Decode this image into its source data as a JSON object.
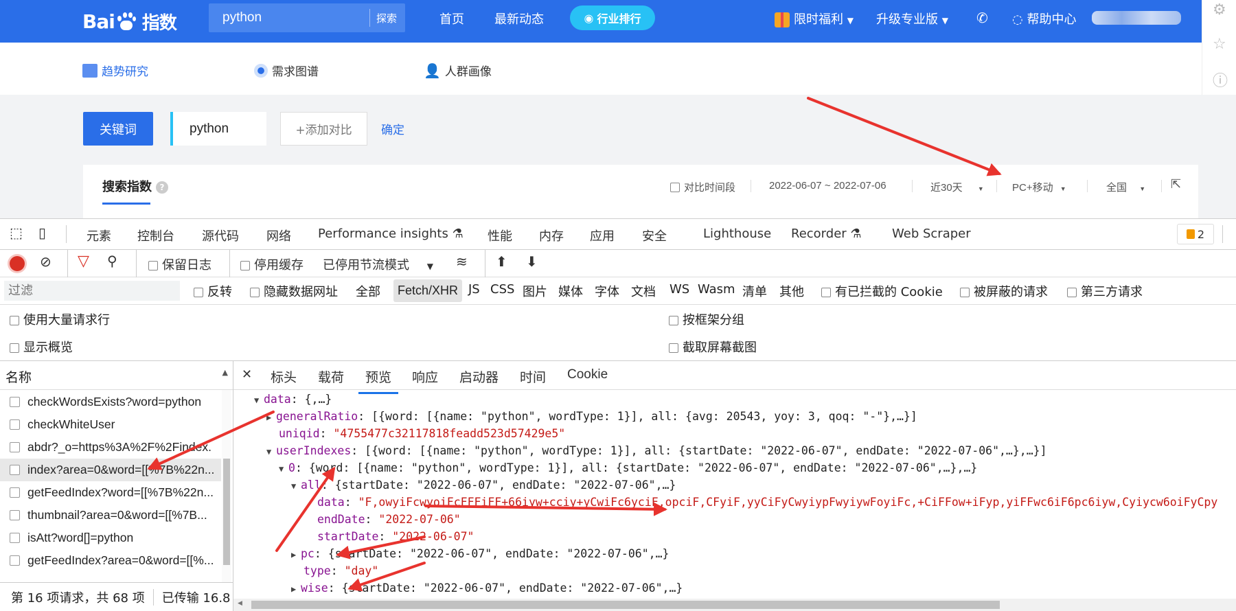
{
  "header": {
    "logo_text": "Bai",
    "logo_cn": "指数",
    "search_value": "python",
    "search_button": "探索",
    "nav": [
      "首页",
      "最新动态"
    ],
    "ranking_pill": "行业排行",
    "promo": "限时福利",
    "upgrade": "升级专业版",
    "help": "帮助中心"
  },
  "subnav": {
    "items": [
      "趋势研究",
      "需求图谱",
      "人群画像"
    ]
  },
  "query": {
    "keyword_label": "关键词",
    "keyword_value": "python",
    "add_compare": "+添加对比",
    "confirm": "确定"
  },
  "panel": {
    "title": "搜索指数",
    "help_icon": "?",
    "compare_period": "对比时间段",
    "date_range": "2022-06-07 ~ 2022-07-06",
    "range_select": "近30天",
    "device_select": "PC+移动",
    "region_select": "全国"
  },
  "devtools": {
    "tabs": [
      "元素",
      "控制台",
      "源代码",
      "网络",
      "Performance insights",
      "性能",
      "内存",
      "应用",
      "安全",
      "Lighthouse",
      "Recorder",
      "Web Scraper"
    ],
    "active_tab": "网络",
    "issues_count": "2",
    "toolbar": {
      "preserve_log": "保留日志",
      "disable_cache": "停用缓存",
      "throttle": "已停用节流模式"
    },
    "filter": {
      "placeholder": "过滤",
      "invert": "反转",
      "hide_data_urls": "隐藏数据网址",
      "types": [
        "全部",
        "Fetch/XHR",
        "JS",
        "CSS",
        "图片",
        "媒体",
        "字体",
        "文档",
        "WS",
        "Wasm",
        "清单",
        "其他"
      ],
      "blocked_cookies": "有已拦截的 Cookie",
      "blocked_requests": "被屏蔽的请求",
      "third_party": "第三方请求"
    },
    "options": {
      "large_rows": "使用大量请求行",
      "group_by_frame": "按框架分组",
      "show_overview": "显示概览",
      "capture_screenshots": "截取屏幕截图"
    },
    "requests": {
      "header": "名称",
      "rows": [
        "checkWordsExists?word=python",
        "checkWhiteUser",
        "abdr?_o=https%3A%2F%2Findex.",
        "index?area=0&word=[[%7B%22n...",
        "getFeedIndex?word=[[%7B%22n...",
        "thumbnail?area=0&word=[[%7B...",
        "isAtt?word[]=python",
        "getFeedIndex?area=0&word=[[%..."
      ],
      "status_requests": "第 16 项请求，共 68 项",
      "status_transferred": "已传输 16.8"
    },
    "detail_tabs": [
      "标头",
      "载荷",
      "预览",
      "响应",
      "启动器",
      "时间",
      "Cookie"
    ],
    "active_detail_tab": "预览",
    "preview": {
      "data_key": "data",
      "data_summary": "{,…}",
      "general_ratio_key": "generalRatio",
      "general_ratio_val": "[{word: [{name: \"python\", wordType: 1}], all: {avg: 20543, yoy: 3, qoq: \"-\"},…}]",
      "uniqid_key": "uniqid",
      "uniqid_val": "\"4755477c32117818feadd523d57429e5\"",
      "user_indexes_key": "userIndexes",
      "user_indexes_val": "[{word: [{name: \"python\", wordType: 1}], all: {startDate: \"2022-06-07\", endDate: \"2022-07-06\",…},…}]",
      "item0_key": "0",
      "item0_val": "{word: [{name: \"python\", wordType: 1}], all: {startDate: \"2022-06-07\", endDate: \"2022-07-06\",…},…}",
      "all_key": "all",
      "all_val": "{startDate: \"2022-06-07\", endDate: \"2022-07-06\",…}",
      "inner_data_key": "data",
      "inner_data_val": "\"F,owyiFcwyoiFcFFFiFF+66iyw+cciy+yCwiFc6yciF,opciF,CFyiF,yyCiFyCwyiypFwyiywFoyiFc,+CiFFow+iFyp,yiFFwc6iF6pc6iyw,Cyiycw6oiFyCpy",
      "end_date_key": "endDate",
      "end_date_val": "\"2022-07-06\"",
      "start_date_key": "startDate",
      "start_date_val": "\"2022-06-07\"",
      "pc_key": "pc",
      "pc_val": "{startDate: \"2022-06-07\", endDate: \"2022-07-06\",…}",
      "type_key": "type",
      "type_val": "\"day\"",
      "wise_key": "wise",
      "wise_val": "{startDate: \"2022-06-07\", endDate: \"2022-07-06\",…}"
    }
  },
  "colors": {
    "baidu_blue": "#2a6ee8",
    "pill_cyan": "#28c1f5",
    "annotation_red": "#e8332e",
    "json_key": "#881391",
    "json_string": "#c41a16"
  }
}
